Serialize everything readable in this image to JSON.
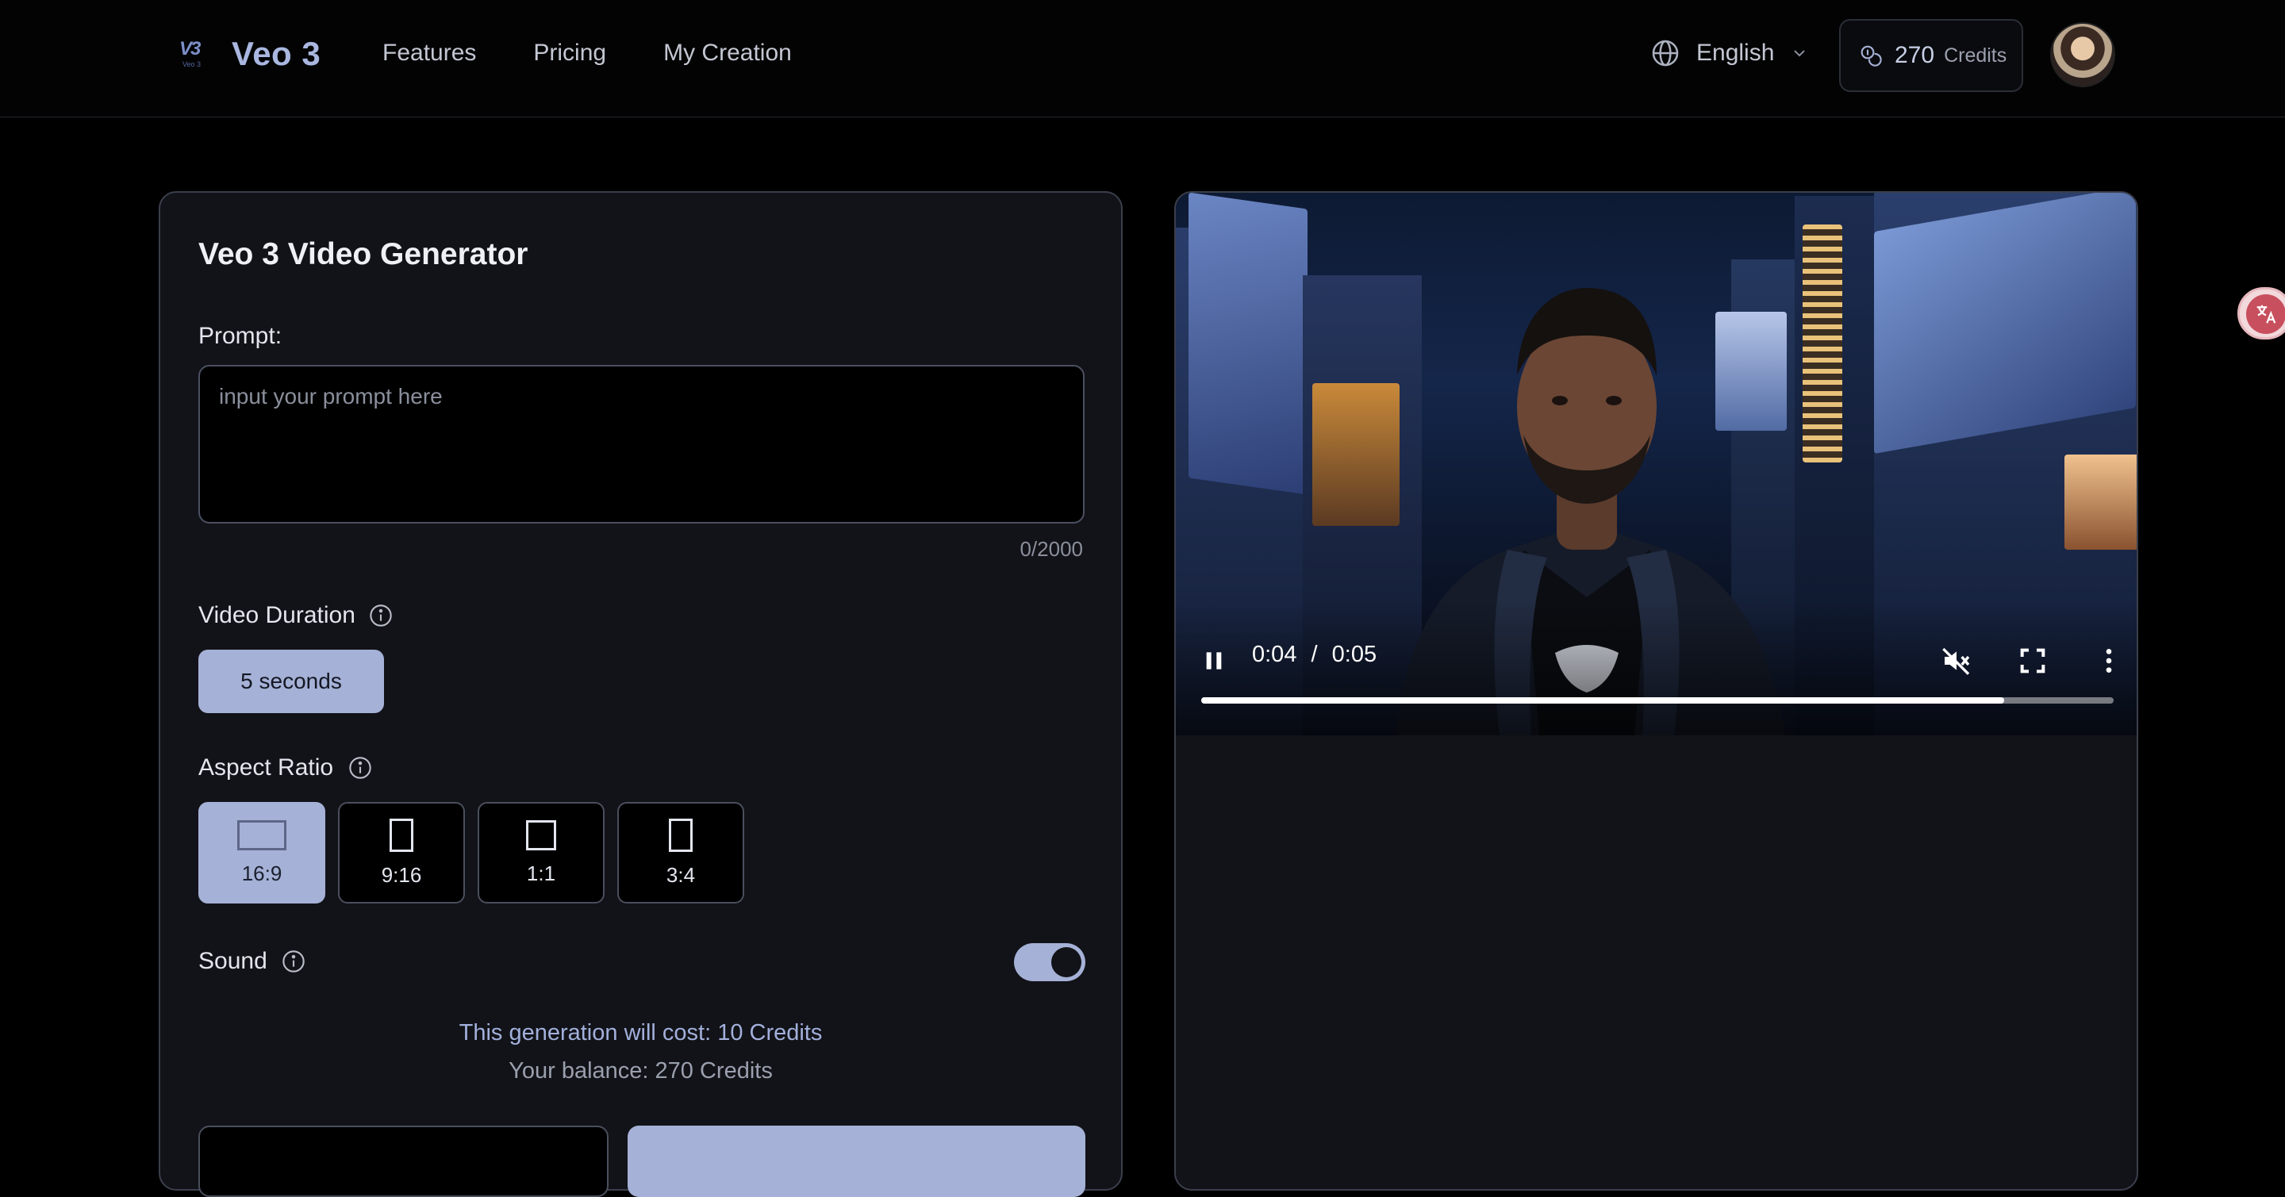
{
  "header": {
    "brand": "Veo 3",
    "logo_mark": "V3",
    "logo_sub": "Veo 3",
    "nav": [
      "Features",
      "Pricing",
      "My Creation"
    ],
    "language": "English",
    "credits_value": "270",
    "credits_label": "Credits"
  },
  "generator": {
    "title": "Veo 3 Video Generator",
    "prompt_label": "Prompt:",
    "prompt_placeholder": "input your prompt here",
    "prompt_value": "",
    "counter": "0/2000",
    "duration_label": "Video Duration",
    "duration_option": "5 seconds",
    "aspect_label": "Aspect Ratio",
    "aspect_options": [
      {
        "label": "16:9",
        "selected": true
      },
      {
        "label": "9:16",
        "selected": false
      },
      {
        "label": "1:1",
        "selected": false
      },
      {
        "label": "3:4",
        "selected": false
      }
    ],
    "sound_label": "Sound",
    "sound_on": true,
    "cost_text": "This generation will cost: 10 Credits",
    "balance_text": "Your balance: 270 Credits"
  },
  "video": {
    "current_time": "0:04",
    "separator": "/",
    "duration": "0:05",
    "progress_fraction": 0.88,
    "muted": true,
    "playing": true
  },
  "colors": {
    "accent": "#a5b1d6",
    "brand": "#a9b7e0",
    "panel": "#121318",
    "border": "#3a3f4c"
  },
  "icons": {
    "lang": "globe-icon",
    "credits": "coins-icon",
    "info": "info-icon",
    "pause": "pause-icon",
    "mute": "volume-muted-icon",
    "fullscreen": "fullscreen-icon",
    "more": "more-vertical-icon",
    "translate": "translate-icon"
  }
}
